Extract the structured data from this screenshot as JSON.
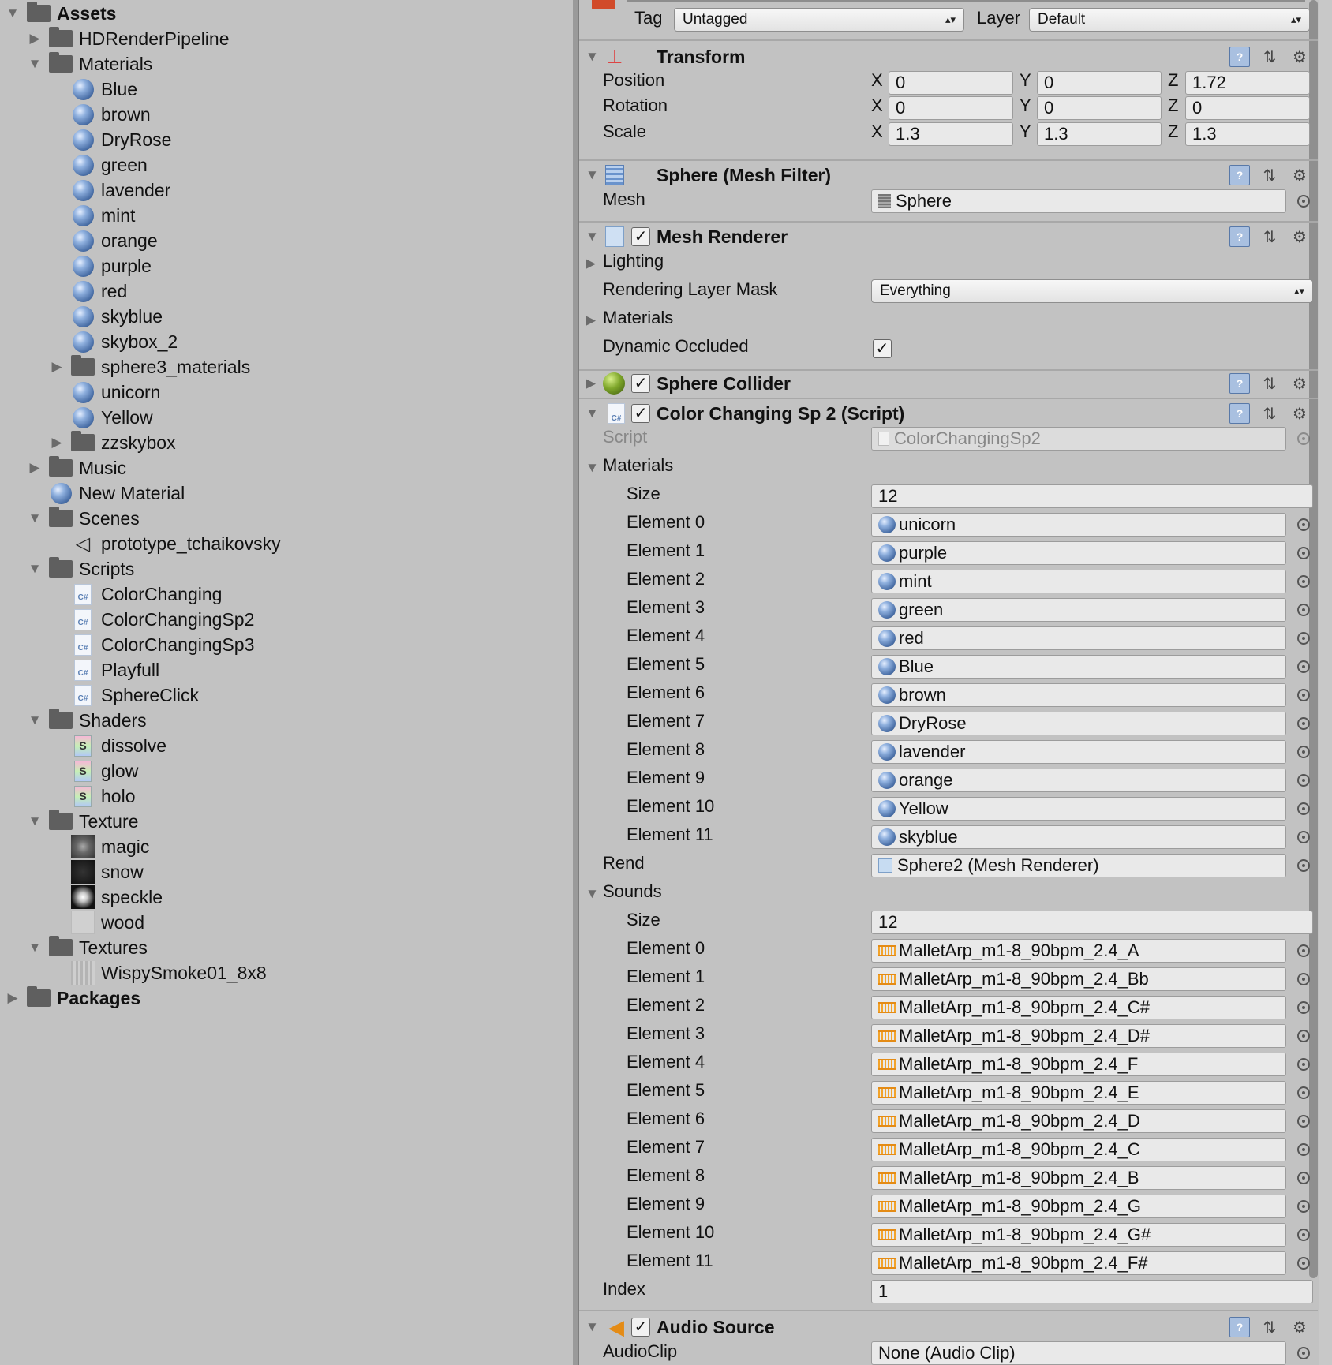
{
  "project": {
    "rows": [
      {
        "label": "Assets",
        "depth": 0,
        "arrow": "down",
        "icon": "folder",
        "bold": true
      },
      {
        "label": "HDRenderPipeline",
        "depth": 1,
        "arrow": "right",
        "icon": "folder"
      },
      {
        "label": "Materials",
        "depth": 1,
        "arrow": "down",
        "icon": "folder"
      },
      {
        "label": "Blue",
        "depth": 2,
        "icon": "material"
      },
      {
        "label": "brown",
        "depth": 2,
        "icon": "material"
      },
      {
        "label": "DryRose",
        "depth": 2,
        "icon": "material"
      },
      {
        "label": "green",
        "depth": 2,
        "icon": "material"
      },
      {
        "label": "lavender",
        "depth": 2,
        "icon": "material"
      },
      {
        "label": "mint",
        "depth": 2,
        "icon": "material"
      },
      {
        "label": "orange",
        "depth": 2,
        "icon": "material"
      },
      {
        "label": "purple",
        "depth": 2,
        "icon": "material"
      },
      {
        "label": "red",
        "depth": 2,
        "icon": "material"
      },
      {
        "label": "skyblue",
        "depth": 2,
        "icon": "material"
      },
      {
        "label": "skybox_2",
        "depth": 2,
        "icon": "material"
      },
      {
        "label": "sphere3_materials",
        "depth": 2,
        "arrow": "right",
        "icon": "folder"
      },
      {
        "label": "unicorn",
        "depth": 2,
        "icon": "material"
      },
      {
        "label": "Yellow",
        "depth": 2,
        "icon": "material"
      },
      {
        "label": "zzskybox",
        "depth": 2,
        "arrow": "right",
        "icon": "folder"
      },
      {
        "label": "Music",
        "depth": 1,
        "arrow": "right",
        "icon": "folder"
      },
      {
        "label": "New Material",
        "depth": 1,
        "icon": "material"
      },
      {
        "label": "Scenes",
        "depth": 1,
        "arrow": "down",
        "icon": "folder"
      },
      {
        "label": "prototype_tchaikovsky",
        "depth": 2,
        "icon": "scene"
      },
      {
        "label": "Scripts",
        "depth": 1,
        "arrow": "down",
        "icon": "folder"
      },
      {
        "label": "ColorChanging",
        "depth": 2,
        "icon": "csharp"
      },
      {
        "label": "ColorChangingSp2",
        "depth": 2,
        "icon": "csharp"
      },
      {
        "label": "ColorChangingSp3",
        "depth": 2,
        "icon": "csharp"
      },
      {
        "label": "Playfull",
        "depth": 2,
        "icon": "csharp"
      },
      {
        "label": "SphereClick",
        "depth": 2,
        "icon": "csharp"
      },
      {
        "label": "Shaders",
        "depth": 1,
        "arrow": "down",
        "icon": "folder"
      },
      {
        "label": "dissolve",
        "depth": 2,
        "icon": "shader"
      },
      {
        "label": "glow",
        "depth": 2,
        "icon": "shader"
      },
      {
        "label": "holo",
        "depth": 2,
        "icon": "shader"
      },
      {
        "label": "Texture",
        "depth": 1,
        "arrow": "down",
        "icon": "folder"
      },
      {
        "label": "magic",
        "depth": 2,
        "icon": "texture-magic"
      },
      {
        "label": "snow",
        "depth": 2,
        "icon": "texture-snow"
      },
      {
        "label": "speckle",
        "depth": 2,
        "icon": "texture-speckle"
      },
      {
        "label": "wood",
        "depth": 2,
        "icon": "texture-wood"
      },
      {
        "label": "Textures",
        "depth": 1,
        "arrow": "down",
        "icon": "folder"
      },
      {
        "label": "WispySmoke01_8x8",
        "depth": 2,
        "icon": "texture-wispy"
      },
      {
        "label": "Packages",
        "depth": 0,
        "arrow": "right",
        "icon": "folder",
        "bold": true
      }
    ]
  },
  "inspector": {
    "tag_label": "Tag",
    "tag_value": "Untagged",
    "layer_label": "Layer",
    "layer_value": "Default",
    "transform": {
      "title": "Transform",
      "rows": [
        {
          "label": "Position",
          "x": "0",
          "y": "0",
          "z": "1.72"
        },
        {
          "label": "Rotation",
          "x": "0",
          "y": "0",
          "z": "0"
        },
        {
          "label": "Scale",
          "x": "1.3",
          "y": "1.3",
          "z": "1.3"
        }
      ],
      "axis_x": "X",
      "axis_y": "Y",
      "axis_z": "Z"
    },
    "mesh_filter": {
      "title": "Sphere (Mesh Filter)",
      "mesh_label": "Mesh",
      "mesh_value": "Sphere"
    },
    "mesh_renderer": {
      "title": "Mesh Renderer",
      "lighting_label": "Lighting",
      "layer_mask_label": "Rendering Layer Mask",
      "layer_mask_value": "Everything",
      "materials_label": "Materials",
      "dynamic_occluded_label": "Dynamic Occluded"
    },
    "sphere_collider": {
      "title": "Sphere Collider"
    },
    "script_comp": {
      "title": "Color Changing Sp 2 (Script)",
      "script_label": "Script",
      "script_value": "ColorChangingSp2",
      "materials_label": "Materials",
      "size_label": "Size",
      "materials_size": "12",
      "materials": [
        "unicorn",
        "purple",
        "mint",
        "green",
        "red",
        "Blue",
        "brown",
        "DryRose",
        "lavender",
        "orange",
        "Yellow",
        "skyblue"
      ],
      "element_labels": [
        "Element 0",
        "Element 1",
        "Element 2",
        "Element 3",
        "Element 4",
        "Element 5",
        "Element 6",
        "Element 7",
        "Element 8",
        "Element 9",
        "Element 10",
        "Element 11"
      ],
      "rend_label": "Rend",
      "rend_value": "Sphere2 (Mesh Renderer)",
      "sounds_label": "Sounds",
      "sounds_size": "12",
      "sounds": [
        "MalletArp_m1-8_90bpm_2.4_A",
        "MalletArp_m1-8_90bpm_2.4_Bb",
        "MalletArp_m1-8_90bpm_2.4_C#",
        "MalletArp_m1-8_90bpm_2.4_D#",
        "MalletArp_m1-8_90bpm_2.4_F",
        "MalletArp_m1-8_90bpm_2.4_E",
        "MalletArp_m1-8_90bpm_2.4_D",
        "MalletArp_m1-8_90bpm_2.4_C",
        "MalletArp_m1-8_90bpm_2.4_B",
        "MalletArp_m1-8_90bpm_2.4_G",
        "MalletArp_m1-8_90bpm_2.4_G#",
        "MalletArp_m1-8_90bpm_2.4_F#"
      ],
      "index_label": "Index",
      "index_value": "1"
    },
    "audio_source": {
      "title": "Audio Source",
      "clip_label": "AudioClip",
      "clip_value": "None (Audio Clip)"
    }
  }
}
